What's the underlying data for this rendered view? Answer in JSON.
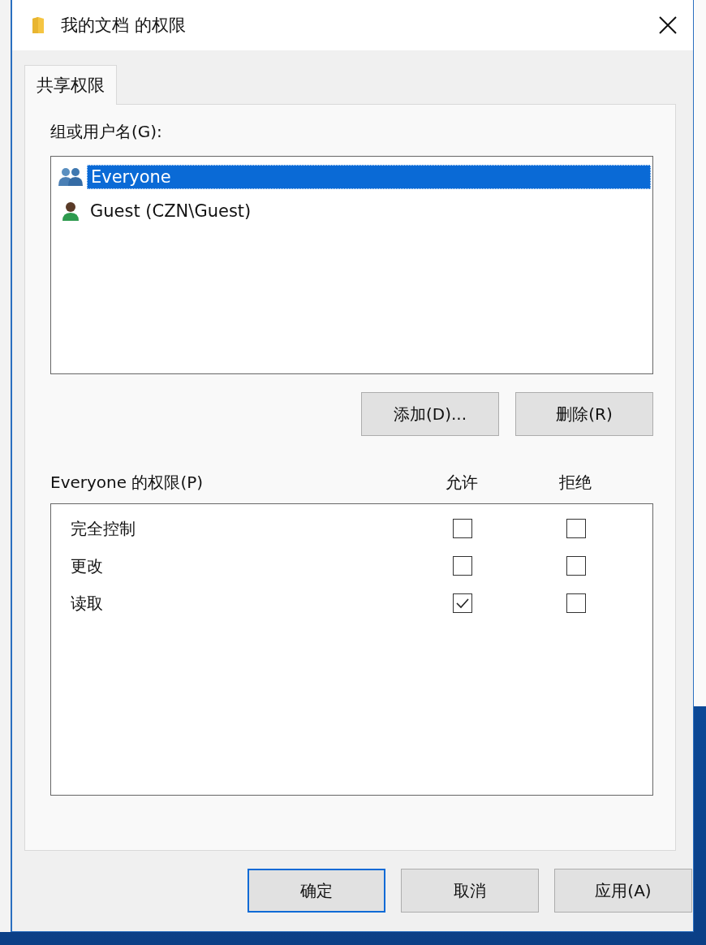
{
  "window": {
    "title": "我的文档 的权限"
  },
  "tabs": [
    {
      "label": "共享权限",
      "selected": true
    }
  ],
  "group_label": "组或用户名(G):",
  "users": [
    {
      "name": "Everyone",
      "kind": "group",
      "selected": true
    },
    {
      "name": "Guest (CZN\\Guest)",
      "kind": "user",
      "selected": false
    }
  ],
  "user_buttons": [
    "添加(D)...",
    "删除(R)"
  ],
  "permissions": {
    "title": "Everyone 的权限(P)",
    "columns": [
      "允许",
      "拒绝"
    ],
    "rows": [
      {
        "name": "完全控制",
        "allow": false,
        "deny": false
      },
      {
        "name": "更改",
        "allow": false,
        "deny": false
      },
      {
        "name": "读取",
        "allow": true,
        "deny": false
      }
    ]
  },
  "buttons": [
    {
      "label": "确定",
      "default": true
    },
    {
      "label": "取消",
      "default": false
    },
    {
      "label": "应用(A)",
      "default": false
    }
  ]
}
